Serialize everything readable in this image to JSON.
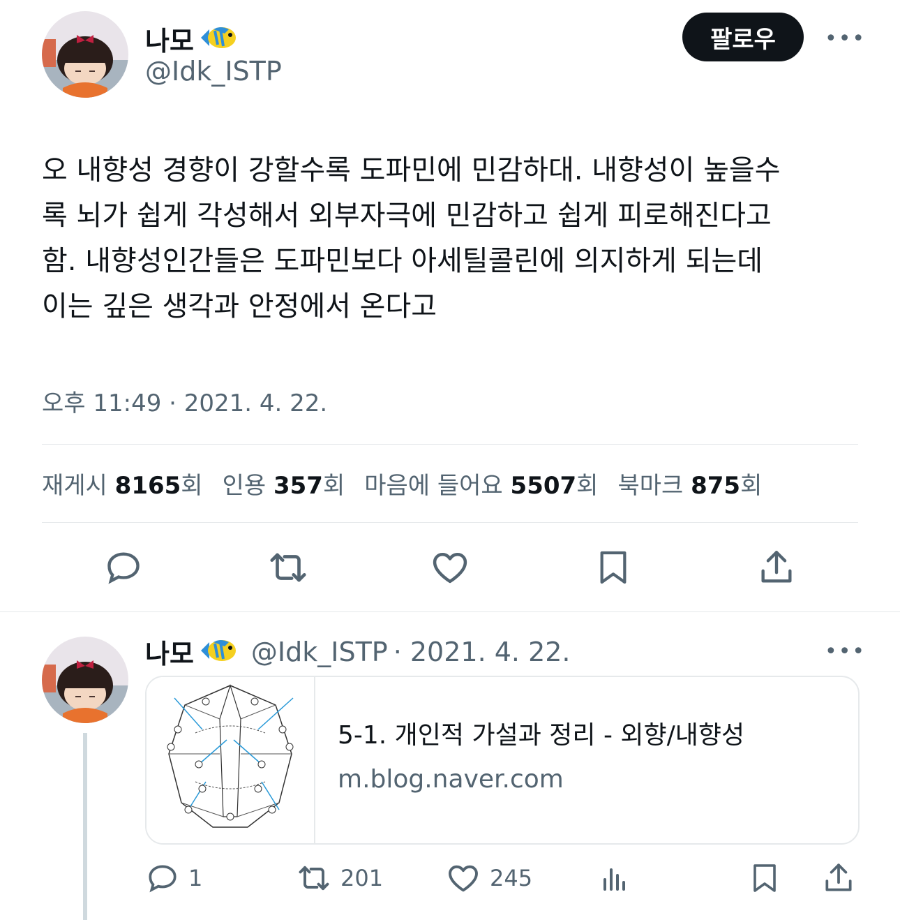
{
  "main_tweet": {
    "author_name": "나모",
    "author_handle": "@Idk_ISTP",
    "follow_label": "팔로우",
    "more_label": "•••",
    "text": "오 내향성 경향이 강할수록 도파민에 민감하대. 내향성이 높을수\n록 뇌가 쉽게 각성해서 외부자극에 민감하고 쉽게 피로해진다고\n함. 내향성인간들은 도파민보다 아세틸콜린에 의지하게 되는데\n이는 깊은 생각과 안정에서 온다고",
    "timestamp": "오후 11:49 · 2021. 4. 22.",
    "stats": {
      "retweets_label": "재게시",
      "retweets": "8165",
      "retweets_unit": "회",
      "quotes_label": "인용",
      "quotes": "357",
      "quotes_unit": "회",
      "likes_label": "마음에 들어요",
      "likes": "5507",
      "likes_unit": "회",
      "bookmarks_label": "북마크",
      "bookmarks": "875",
      "bookmarks_unit": "회"
    },
    "actions": [
      "reply-icon",
      "retweet-icon",
      "heart-icon",
      "bookmark-icon",
      "share-icon"
    ]
  },
  "reply_tweet": {
    "author_name": "나모",
    "author_handle": "@Idk_ISTP",
    "date": "· 2021. 4. 22.",
    "more_label": "•••",
    "card": {
      "title": "5-1. 개인적 가설과 정리 - 외향/내향성",
      "domain": "m.blog.naver.com"
    },
    "counts": {
      "replies": "1",
      "retweets": "201",
      "likes": "245"
    }
  },
  "colors": {
    "text_primary": "#0f1419",
    "text_secondary": "#536471",
    "divider": "#e6e9eb",
    "thread_line": "#cfd9de"
  }
}
